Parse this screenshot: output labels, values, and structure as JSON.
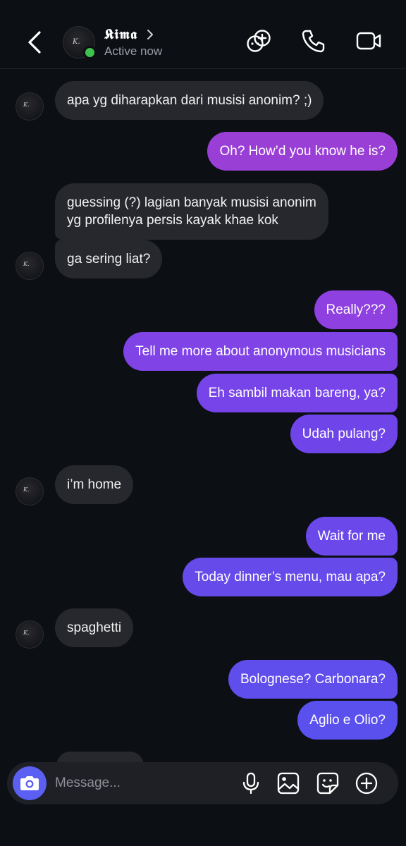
{
  "header": {
    "name": "𝕶𝖎𝖒𝖆",
    "status": "Active now",
    "avatar_mark": "K."
  },
  "messages": [
    {
      "side": "in",
      "text": [
        "apa yg diharapkan dari musisi anonim? ;)"
      ],
      "avatar": true
    },
    {
      "side": "out",
      "text": [
        "Oh? How’d you know he is?"
      ],
      "color": "#9a3fd6"
    },
    {
      "side": "in",
      "text": [
        "guessing (?) lagian banyak musisi anonim",
        "yg profilenya persis kayak khae kok"
      ],
      "avatar": false
    },
    {
      "side": "in",
      "text": [
        "ga sering liat?"
      ],
      "avatar": true
    },
    {
      "side": "out",
      "text": [
        "Really???"
      ],
      "color": "#8e40e0"
    },
    {
      "side": "out",
      "text": [
        "Tell me more about anonymous musicians"
      ],
      "color": "#7f43e6"
    },
    {
      "side": "out",
      "text": [
        "Eh sambil makan bareng, ya?"
      ],
      "color": "#7644e8"
    },
    {
      "side": "out",
      "text": [
        "Udah pulang?"
      ],
      "color": "#6f45e9"
    },
    {
      "side": "in",
      "text": [
        "i’m home"
      ],
      "avatar": true
    },
    {
      "side": "out",
      "text": [
        "Wait for me"
      ],
      "color": "#6a48ea"
    },
    {
      "side": "out",
      "text": [
        "Today dinner’s menu, mau apa?"
      ],
      "color": "#664aea"
    },
    {
      "side": "in",
      "text": [
        "spaghetti"
      ],
      "avatar": true
    },
    {
      "side": "out",
      "text": [
        "Bolognese? Carbonara?"
      ],
      "color": "#5f4dec"
    },
    {
      "side": "out",
      "text": [
        "Aglio e Olio?"
      ],
      "color": "#5a50ed"
    }
  ],
  "composer": {
    "placeholder": "Message..."
  },
  "icons": {
    "back": "chevron-left-icon",
    "games": "game-controller-icon",
    "call": "phone-icon",
    "video": "video-camera-icon",
    "camera": "camera-icon",
    "mic": "microphone-icon",
    "gallery": "image-icon",
    "sticker": "sticker-icon",
    "add": "plus-circle-icon"
  }
}
